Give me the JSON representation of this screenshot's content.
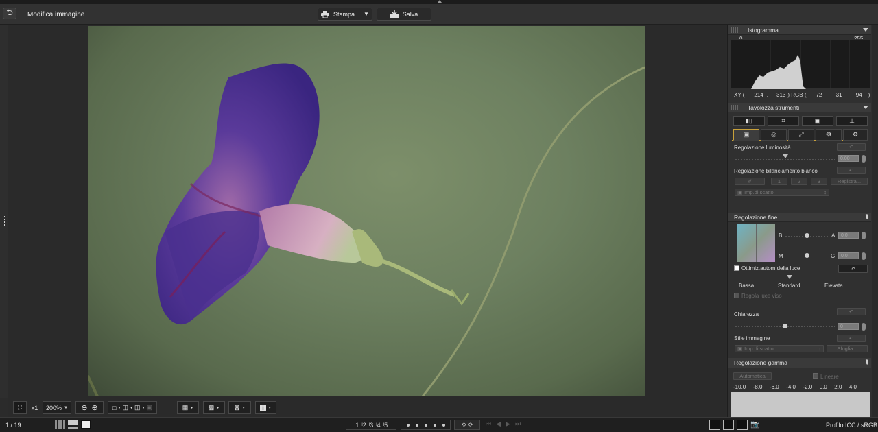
{
  "window": {
    "title": "Modifica immagine"
  },
  "toolbar": {
    "print_label": "Stampa",
    "save_label": "Salva"
  },
  "zoom": {
    "fit": "",
    "one_to_one": "x1",
    "level": "200%"
  },
  "status": {
    "page_counter": "1 / 19",
    "profile": "Profilo ICC / sRGB"
  },
  "rating": {
    "labels": [
      "1",
      "2",
      "3",
      "4",
      "5"
    ]
  },
  "histogram": {
    "title": "Istogramma",
    "min_label": "0",
    "max_label": "255",
    "xy_label": "XY (",
    "x": "214",
    "comma1": ",",
    "y": "313",
    "rgb_label": ") RGB (",
    "r": "72",
    "comma2": ",",
    "g": "31",
    "comma3": ",",
    "b": "94",
    "close": ")"
  },
  "palette": {
    "title": "Tavolozza strumenti",
    "brightness_label": "Regolazione luminosità",
    "brightness_value": "0.00",
    "wb_label": "Regolazione bilanciamento bianco",
    "wb_preset_1": "1",
    "wb_preset_2": "2",
    "wb_preset_3": "3",
    "wb_register": "Registra...",
    "wb_dropdown": "Imp.di scatto"
  },
  "fine_adjust": {
    "title": "Regolazione fine",
    "b_label": "B",
    "a_label": "A",
    "a_value": "0.0",
    "m_label": "M",
    "g_label": "G",
    "g_value": "0.0",
    "auto_light_label": "Ottimiz.autom.della luce",
    "level_low": "Bassa",
    "level_standard": "Standard",
    "level_high": "Elevata",
    "face_light_label": "Regola luce viso",
    "clarity_label": "Chiarezza",
    "clarity_value": "0",
    "style_label": "Stile immagine",
    "style_dropdown": "Imp.di scatto",
    "style_browse": "Sfoglia..."
  },
  "gamma": {
    "title": "Regolazione gamma",
    "auto_label": "Automatica",
    "linear_label": "Lineare",
    "ticks": [
      "-10,0",
      "-8,0",
      "-6,0",
      "-4,0",
      "-2,0",
      "0,0",
      "2,0",
      "4,0"
    ]
  },
  "colors": {
    "accent": "#c8a13a",
    "panel": "#303030",
    "bg": "#2b2b2b"
  }
}
